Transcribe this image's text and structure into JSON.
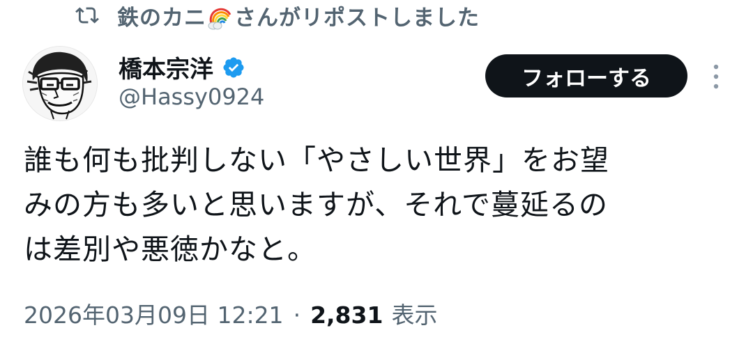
{
  "repost": {
    "text_before": "鉄のカニ",
    "text_after": "さんがリポストしました"
  },
  "author": {
    "display_name": "橋本宗洋",
    "handle": "@Hassy0924",
    "verified": true
  },
  "follow_button_label": "フォローする",
  "tweet": {
    "lines": [
      "誰も何も批判しない「やさしい世界」をお望",
      "みの方も多いと思いますが、それで蔓延るの",
      "は差別や悪徳かなと。"
    ]
  },
  "meta": {
    "timestamp": "2026年03月09日 12:21",
    "separator": "·",
    "views_count": "2,831",
    "views_label": "表示"
  },
  "colors": {
    "text_primary": "#0f1419",
    "text_secondary": "#536471",
    "verified_blue": "#1d9bf0",
    "button_bg": "#0f1419"
  },
  "icons": {
    "repost": "repost-icon",
    "verified": "verified-badge-icon",
    "more": "more-vertical-icon",
    "emoji": "rainbow-cloud-emoji"
  }
}
